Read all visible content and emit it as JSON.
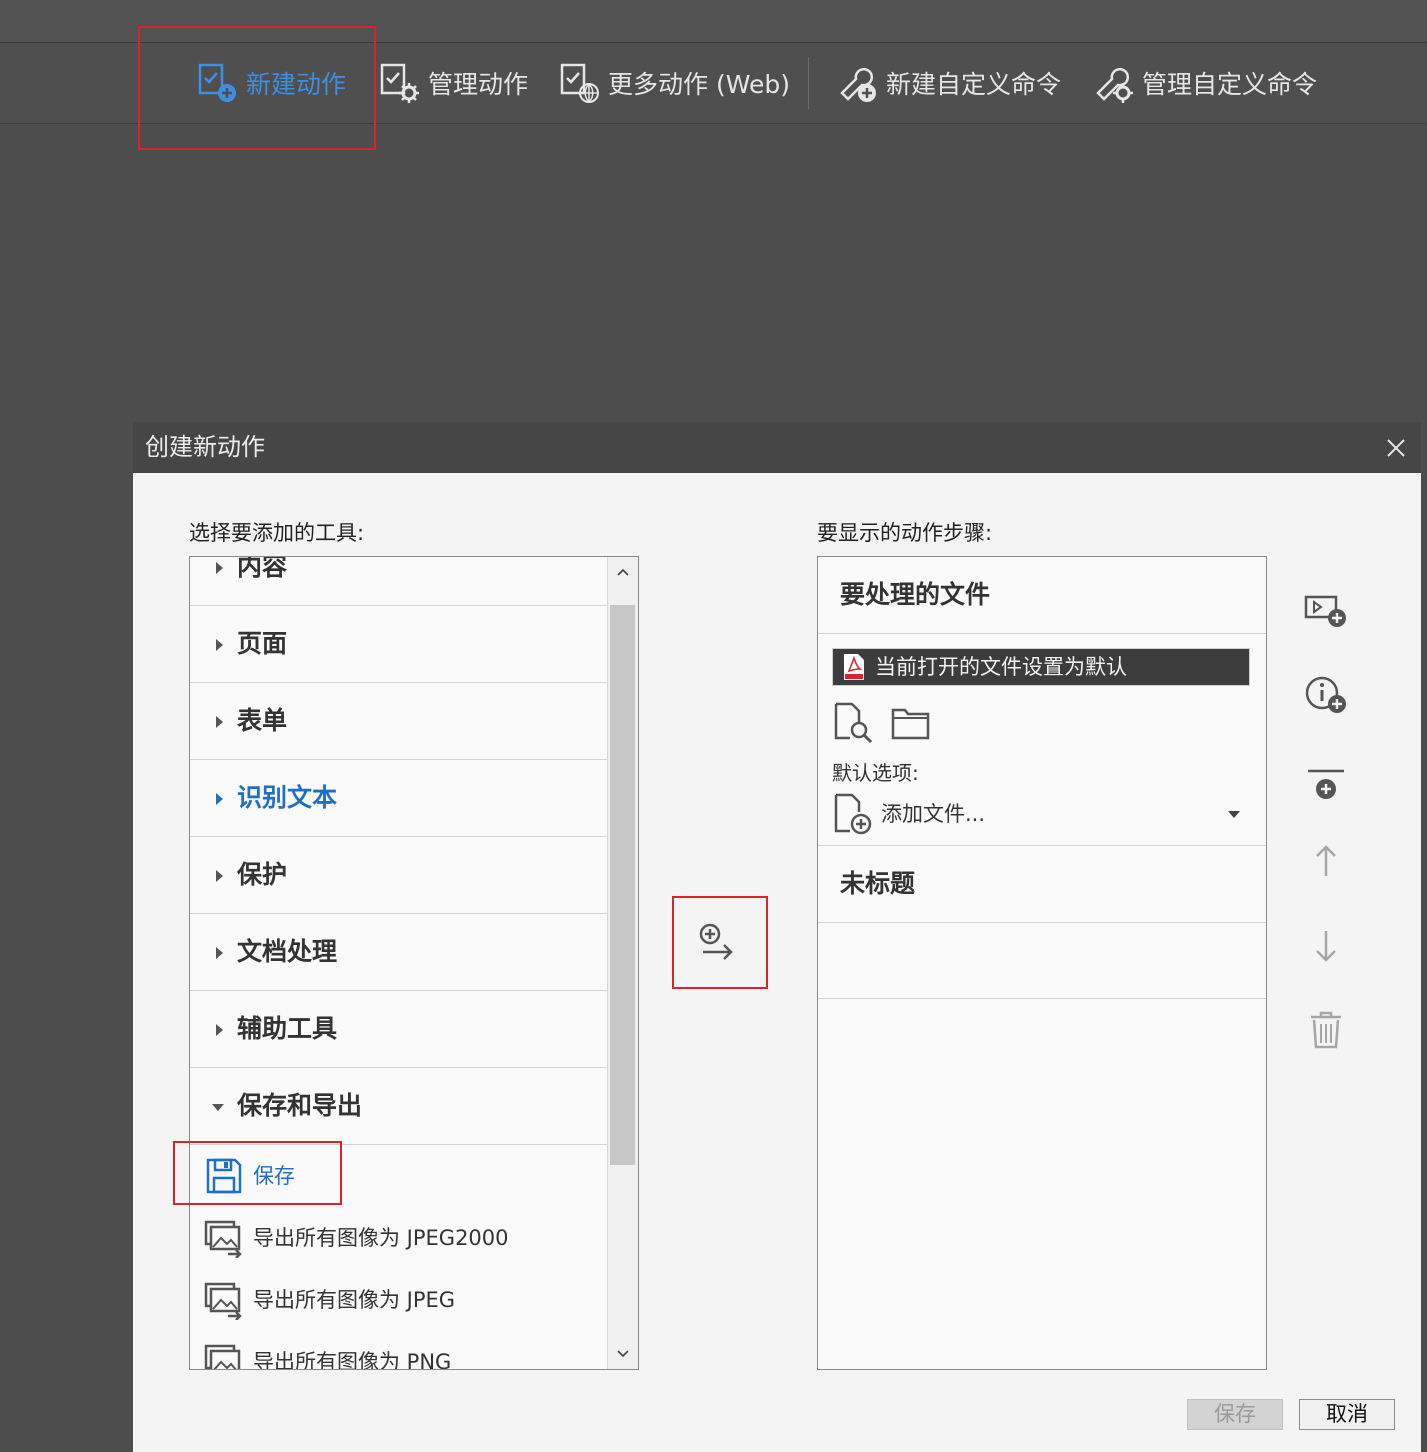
{
  "toolbar": {
    "items": [
      {
        "label": "新建动作",
        "icon": "new-action-icon",
        "active": true
      },
      {
        "label": "管理动作",
        "icon": "manage-actions-icon"
      },
      {
        "label": "更多动作 (Web)",
        "icon": "more-actions-web-icon"
      },
      {
        "label": "新建自定义命令",
        "icon": "new-custom-command-icon"
      },
      {
        "label": "管理自定义命令",
        "icon": "manage-custom-command-icon"
      }
    ]
  },
  "dialog": {
    "title": "创建新动作",
    "tools_label": "选择要添加的工具:",
    "steps_label": "要显示的动作步骤:",
    "categories": [
      {
        "label": "内容"
      },
      {
        "label": "页面"
      },
      {
        "label": "表单"
      },
      {
        "label": "识别文本",
        "active": true
      },
      {
        "label": "保护"
      },
      {
        "label": "文档处理"
      },
      {
        "label": "辅助工具"
      },
      {
        "label": "保存和导出",
        "expanded": true
      }
    ],
    "tools": [
      {
        "label": "保存",
        "icon": "save-icon",
        "active": true
      },
      {
        "label": "导出所有图像为 JPEG2000",
        "icon": "export-images-icon"
      },
      {
        "label": "导出所有图像为 JPEG",
        "icon": "export-images-icon"
      },
      {
        "label": "导出所有图像为 PNG",
        "icon": "export-images-icon"
      }
    ],
    "steps": {
      "files_header": "要处理的文件",
      "file_option": "当前打开的文件设置为默认",
      "default_options_label": "默认选项:",
      "add_files": "添加文件...",
      "untitled": "未标题"
    },
    "buttons": {
      "save": "保存",
      "cancel": "取消"
    }
  },
  "colors": {
    "accent": "#1f6fc5",
    "toolbar_active": "#3d8fe0",
    "highlight_box": "#d9232d"
  }
}
